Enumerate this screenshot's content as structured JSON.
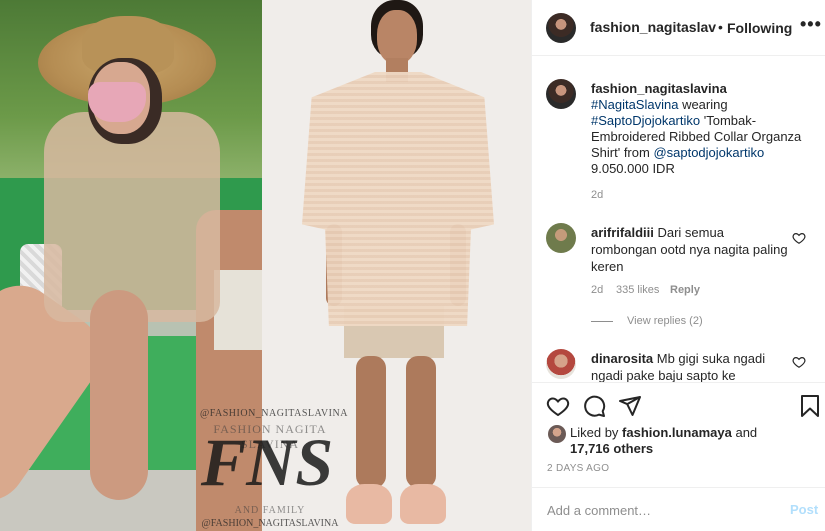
{
  "media": {
    "watermark_handle_top": "@FASHION_NAGITASLAVINA",
    "watermark_name": "FASHION NAGITA SLAVINA",
    "watermark_logo": "FNS",
    "watermark_family": "AND FAMILY",
    "watermark_handle_bottom": "@FASHION_NAGITASLAVINA"
  },
  "header": {
    "username": "fashion_nagitaslavina",
    "separator": "•",
    "follow_state": "Following",
    "more": "•••"
  },
  "caption": {
    "username": "fashion_nagitaslavina",
    "hashtag1": "#NagitaSlavina",
    "text1": " wearing ",
    "hashtag2": "#SaptoDjojokartiko",
    "text2": " 'Tombak-Embroidered Ribbed Collar Organza Shirt' from ",
    "mention": "@saptodjojokartiko",
    "text3": " 9.050.000 IDR",
    "age": "2d"
  },
  "comments": [
    {
      "username": "arifrifaldiii",
      "text": " Dari semua rombongan ootd nya nagita paling keren",
      "age": "2d",
      "likes": "335 likes",
      "reply": "Reply",
      "view_replies": "View replies (2)"
    },
    {
      "username": "dinarosita",
      "text": " Mb gigi suka ngadi ngadi pake baju sapto ke"
    }
  ],
  "actions": {
    "liked_by_prefix": "Liked by ",
    "liked_by_user": "fashion.lunamaya",
    "liked_by_and": " and",
    "others": "17,716 others",
    "time": "2 DAYS AGO"
  },
  "add_comment": {
    "placeholder": "Add a comment…",
    "post_label": "Post"
  },
  "icons": {
    "heart": "heart-icon",
    "comment": "comment-icon",
    "share": "share-icon",
    "bookmark": "bookmark-icon"
  }
}
